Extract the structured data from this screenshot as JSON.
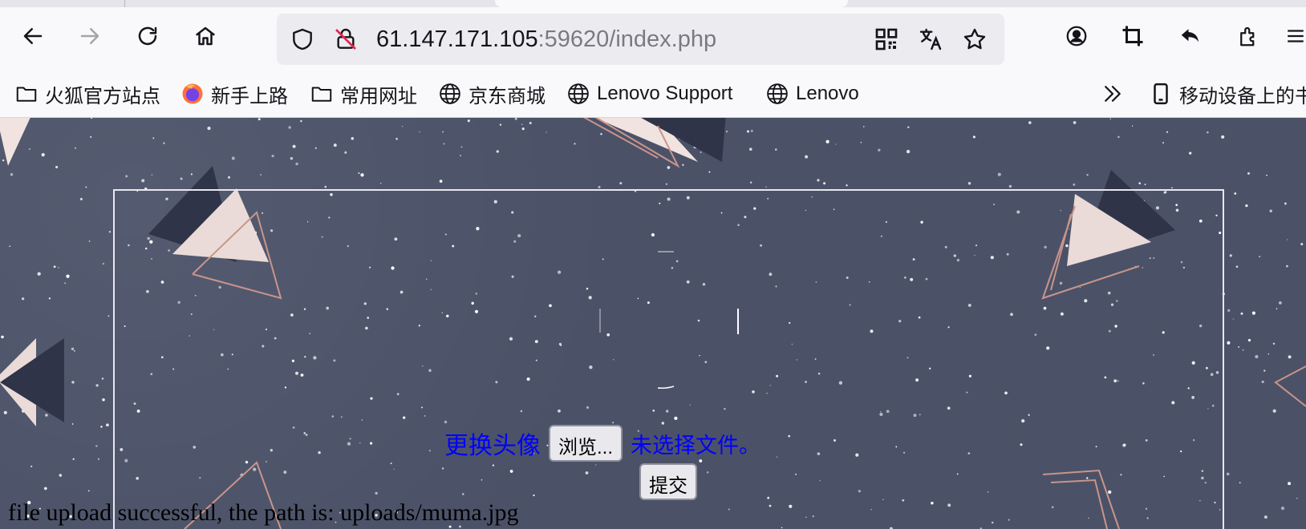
{
  "browser": {
    "url_host": "61.147.171.105",
    "url_rest": ":59620/index.php"
  },
  "bookmarks": [
    {
      "label": "火狐官方站点",
      "icon": "folder-icon"
    },
    {
      "label": "新手上路",
      "icon": "firefox-icon"
    },
    {
      "label": "常用网址",
      "icon": "folder-icon"
    },
    {
      "label": "京东商城",
      "icon": "globe-icon"
    },
    {
      "label": "Lenovo Support",
      "icon": "globe-icon"
    },
    {
      "label": "Lenovo",
      "icon": "globe-icon"
    }
  ],
  "bookmarks_mobile": "移动设备上的书",
  "page": {
    "upload_label": "更换头像",
    "browse_label": "浏览...",
    "no_file_label": "未选择文件。",
    "submit_label": "提交",
    "result_text": "file upload successful, the path is: uploads/muma.jpg"
  },
  "colors": {
    "page_background": "#4b5268",
    "link_blue": "#0000ff"
  }
}
